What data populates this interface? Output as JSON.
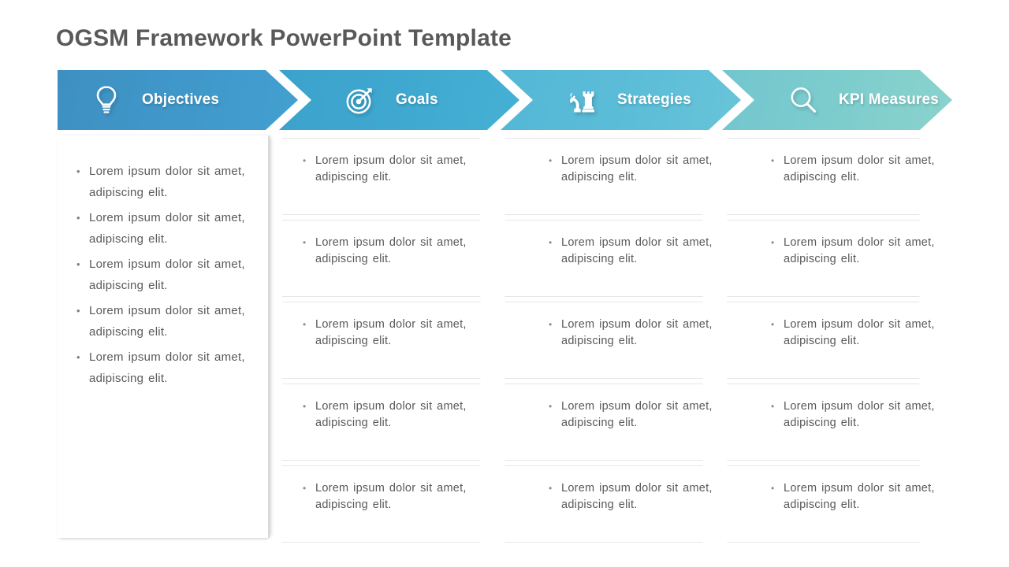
{
  "slide": {
    "title": "OGSM Framework PowerPoint Template",
    "title_color": "#595959",
    "background": "#ffffff"
  },
  "header": {
    "segments": [
      {
        "label": "Objectives",
        "icon": "lightbulb-icon",
        "color": "#4098ca"
      },
      {
        "label": "Goals",
        "icon": "target-dart-icon",
        "color": "#40a9d0"
      },
      {
        "label": "Strategies",
        "icon": "chess-pieces-icon",
        "color": "#5cbdd8"
      },
      {
        "label": "KPI Measures",
        "icon": "magnifying-glass-icon",
        "color": "#7ecdcd"
      }
    ]
  },
  "objectives_panel": {
    "bullets": [
      "Lorem ipsum dolor sit amet, adipiscing elit.",
      "Lorem ipsum dolor sit amet, adipiscing elit.",
      "Lorem ipsum dolor sit amet, adipiscing elit.",
      "Lorem ipsum dolor sit amet, adipiscing elit.",
      "Lorem ipsum dolor sit amet, adipiscing elit."
    ]
  },
  "body_grid": {
    "columns": [
      {
        "name": "goals",
        "cells": [
          "Lorem ipsum dolor sit amet, adipiscing elit.",
          "Lorem ipsum dolor sit amet, adipiscing elit.",
          "Lorem ipsum dolor sit amet, adipiscing elit.",
          "Lorem ipsum dolor sit amet, adipiscing elit.",
          "Lorem ipsum dolor sit amet, adipiscing elit."
        ]
      },
      {
        "name": "strategies",
        "cells": [
          "Lorem ipsum dolor sit amet, adipiscing elit.",
          "Lorem ipsum dolor sit amet, adipiscing elit.",
          "Lorem ipsum dolor sit amet, adipiscing elit.",
          "Lorem ipsum dolor sit amet, adipiscing elit.",
          "Lorem ipsum dolor sit amet, adipiscing elit."
        ]
      },
      {
        "name": "kpi-measures",
        "cells": [
          "Lorem ipsum dolor sit amet, adipiscing elit.",
          "Lorem ipsum dolor sit amet, adipiscing elit.",
          "Lorem ipsum dolor sit amet, adipiscing elit.",
          "Lorem ipsum dolor sit amet, adipiscing elit.",
          "Lorem ipsum dolor sit amet, adipiscing elit."
        ]
      }
    ]
  },
  "bullet_glyph": "•"
}
